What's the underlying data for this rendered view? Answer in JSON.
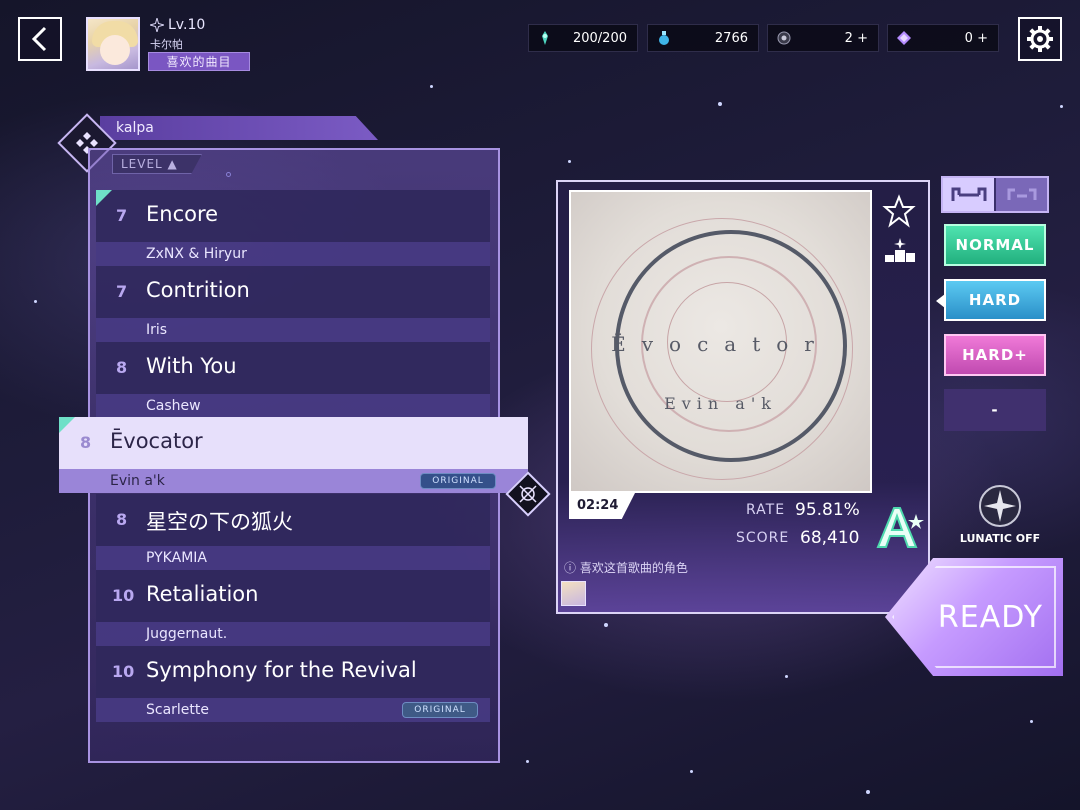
{
  "player": {
    "level": "Lv.10",
    "name": "卡尔帕",
    "favorite_tag": "喜欢的曲目"
  },
  "resources": [
    {
      "icon": "stamina-icon",
      "value": "200/200",
      "plus": ""
    },
    {
      "icon": "potion-icon",
      "value": "2766",
      "plus": ""
    },
    {
      "icon": "orb-icon",
      "value": "2",
      "plus": "+"
    },
    {
      "icon": "crystal-icon",
      "value": "0",
      "plus": "+"
    }
  ],
  "pack": {
    "name": "kalpa",
    "sort_label": "LEVEL ▲"
  },
  "songs": [
    {
      "level": "7",
      "title": "Encore",
      "artist": "ZxNX & Hiryur",
      "badge": ""
    },
    {
      "level": "7",
      "title": "Contrition",
      "artist": "Iris",
      "badge": ""
    },
    {
      "level": "8",
      "title": "With You",
      "artist": "Cashew",
      "badge": ""
    },
    {
      "level": "8",
      "title": "Ēvocator",
      "artist": "Evin a'k",
      "badge": "ORIGINAL"
    },
    {
      "level": "8",
      "title": "星空の下の狐火",
      "artist": "PYKAMIA",
      "badge": ""
    },
    {
      "level": "10",
      "title": "Retaliation",
      "artist": "Juggernaut.",
      "badge": ""
    },
    {
      "level": "10",
      "title": "Symphony for the Revival",
      "artist": "Scarlette",
      "badge": "ORIGINAL"
    }
  ],
  "detail": {
    "jacket_title": "Ēvocator",
    "jacket_artist": "Evin a'k",
    "duration": "02:24",
    "rate_label": "RATE",
    "rate_value": "95.81%",
    "score_label": "SCORE",
    "score_value": "68,410",
    "grade": "A+",
    "fav_note": "ⓘ 喜欢这首歌曲的角色"
  },
  "difficulties": [
    {
      "label": "NORMAL",
      "color": "#3fd9a0",
      "text": "#ffffff"
    },
    {
      "label": "HARD",
      "color": "#4fb6e6",
      "text": "#ffffff",
      "selected": true
    },
    {
      "label": "HARD+",
      "color": "#e067c9",
      "text": "#ffffff"
    },
    {
      "label": "-",
      "color": "#3d2a66",
      "text": "#ffffff"
    }
  ],
  "lunatic_label": "LUNATIC OFF",
  "ready_label": "READY"
}
